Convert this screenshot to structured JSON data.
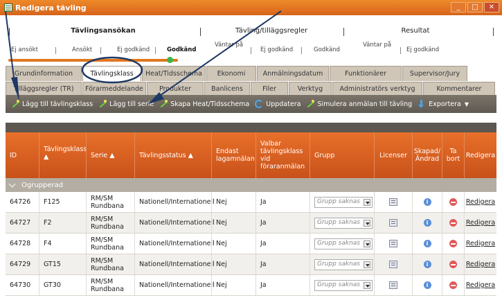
{
  "window": {
    "title": "Redigera tävling"
  },
  "steps": {
    "groups": [
      {
        "title": "Tävlingsansökan",
        "steps": [
          "Ej ansökt",
          "Ansökt",
          "Ej godkänd",
          "Godkänd"
        ],
        "active_step": "Godkänd"
      },
      {
        "title": "Tävling/tilläggsregler",
        "steps": [
          "Väntar på",
          "Ej godkänd",
          "Godkänd"
        ]
      },
      {
        "title": "Resultat",
        "steps": [
          "Väntar på",
          "Ej godkänd"
        ]
      }
    ]
  },
  "tabs_row1": [
    "Grundinformation",
    "Tävlingsklass",
    "Heat/Tidsschema",
    "Ekonomi",
    "Anmälningsdatum",
    "Funktionärer",
    "Supervisor/Jury"
  ],
  "tabs_row2": [
    "Tilläggsregler (TR)",
    "Förarmeddelande",
    "Produkter",
    "Banlicens",
    "Filer",
    "Verktyg",
    "Administratörs verktyg",
    "Kommentarer"
  ],
  "active_tab": "Tävlingsklass",
  "toolbar": {
    "add_class": "Lägg till tävlingsklass",
    "add_series": "Lägg till serie",
    "create_heat": "Skapa Heat/Tidsschema",
    "update": "Uppdatera",
    "simulate": "Simulera anmälan till tävling",
    "export": "Exportera"
  },
  "table": {
    "headers": {
      "id": "ID",
      "class": "Tävlingsklass",
      "series": "Serie",
      "status": "Tävlingsstatus",
      "team_only": "Endast lagamnälan",
      "selectable": "Valbar tävlingsklass vid föraranmälan",
      "group": "Grupp",
      "licenses": "Licenser",
      "created": "Skapad/ Ändrad",
      "delete": "Ta bort",
      "edit": "Redigera"
    },
    "group_label": "Ogrupperad",
    "rows": [
      {
        "id": "64726",
        "class": "F125",
        "series": "RM/SM Rundbana",
        "status": "Nationell/Internationell",
        "team_only": "Nej",
        "selectable": "Ja",
        "group": "Grupp saknas",
        "edit": "Redigera"
      },
      {
        "id": "64727",
        "class": "F2",
        "series": "RM/SM Rundbana",
        "status": "Nationell/Internationell",
        "team_only": "Nej",
        "selectable": "Ja",
        "group": "Grupp saknas",
        "edit": "Redigera"
      },
      {
        "id": "64728",
        "class": "F4",
        "series": "RM/SM Rundbana",
        "status": "Nationell/Internationell",
        "team_only": "Nej",
        "selectable": "Ja",
        "group": "Grupp saknas",
        "edit": "Redigera"
      },
      {
        "id": "64729",
        "class": "GT15",
        "series": "RM/SM Rundbana",
        "status": "Nationell/Internationell",
        "team_only": "Nej",
        "selectable": "Ja",
        "group": "Grupp saknas",
        "edit": "Redigera"
      },
      {
        "id": "64730",
        "class": "GT30",
        "series": "RM/SM Rundbana",
        "status": "Nationell/Internationell",
        "team_only": "Nej",
        "selectable": "Ja",
        "group": "Grupp saknas",
        "edit": "Redigera"
      }
    ]
  },
  "colors": {
    "accent": "#e0781e",
    "header_orange": "#d95f20",
    "toolbar": "#6b665e",
    "annotation": "#1f3864"
  }
}
